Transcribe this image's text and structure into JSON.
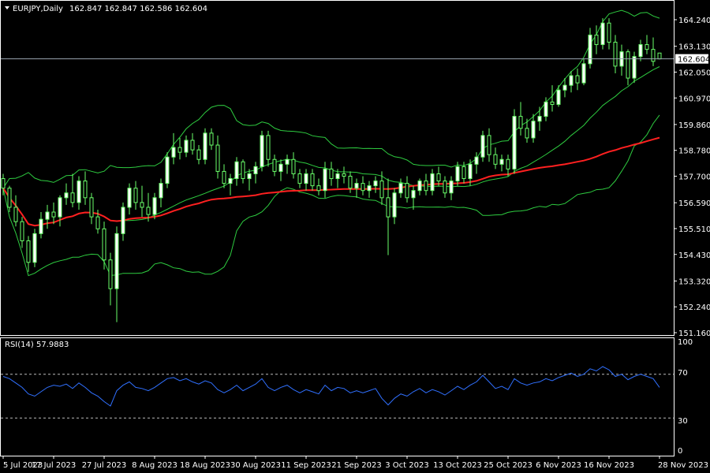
{
  "header": {
    "symbol": "EURJPY,Daily",
    "ohlc": "162.847 162.847 162.586 162.604",
    "price_tag": "162.604"
  },
  "indicator": {
    "label": "RSI(14) 57.9883",
    "levels": [
      "100",
      "70",
      "30",
      "0"
    ]
  },
  "colors": {
    "background": "#000000",
    "frame": "#ffffff",
    "bollinger": "#2ecc40",
    "ma": "#ff2020",
    "rsi": "#3070ff",
    "bull_body": "#ffffff",
    "bear_body": "#000000",
    "wick": "#6aff6a"
  },
  "chart_data": [
    {
      "type": "candlestick",
      "title": "EURJPY,Daily",
      "yticks": [
        "164.240",
        "163.130",
        "162.050",
        "160.970",
        "159.860",
        "158.780",
        "157.700",
        "156.590",
        "155.510",
        "154.430",
        "153.320",
        "152.240",
        "151.160"
      ],
      "ylim": [
        151.16,
        164.24
      ],
      "xticks": [
        "5 Jul 2023",
        "17 Jul 2023",
        "27 Jul 2023",
        "8 Aug 2023",
        "18 Aug 2023",
        "30 Aug 2023",
        "11 Sep 2023",
        "21 Sep 2023",
        "3 Oct 2023",
        "13 Oct 2023",
        "25 Oct 2023",
        "6 Nov 2023",
        "16 Nov 2023",
        "28 Nov 2023"
      ],
      "current_price": 162.604,
      "series": [
        {
          "values": [
            [
              157.6,
              157.8,
              156.9,
              157.2
            ],
            [
              157.2,
              157.3,
              156.2,
              156.4
            ],
            [
              156.4,
              156.9,
              155.6,
              155.8
            ],
            [
              155.8,
              156.0,
              154.7,
              155.0
            ],
            [
              155.0,
              155.2,
              153.7,
              154.1
            ],
            [
              154.1,
              155.5,
              153.9,
              155.3
            ],
            [
              155.3,
              156.2,
              155.1,
              155.9
            ],
            [
              155.9,
              156.5,
              155.5,
              156.2
            ],
            [
              156.2,
              156.6,
              155.7,
              156.0
            ],
            [
              156.0,
              156.9,
              155.6,
              156.8
            ],
            [
              156.8,
              157.4,
              156.5,
              157.0
            ],
            [
              157.0,
              157.8,
              156.4,
              156.6
            ],
            [
              156.6,
              157.7,
              156.3,
              157.5
            ],
            [
              157.5,
              157.9,
              156.5,
              156.8
            ],
            [
              156.8,
              157.0,
              155.7,
              156.0
            ],
            [
              156.0,
              156.3,
              155.3,
              155.5
            ],
            [
              155.5,
              155.8,
              153.8,
              154.2
            ],
            [
              154.2,
              154.5,
              152.3,
              153.0
            ],
            [
              153.0,
              155.6,
              151.6,
              155.3
            ],
            [
              155.3,
              156.6,
              155.0,
              156.4
            ],
            [
              156.4,
              157.4,
              156.1,
              157.2
            ],
            [
              157.2,
              157.5,
              156.3,
              156.6
            ],
            [
              156.6,
              157.3,
              156.0,
              156.4
            ],
            [
              156.4,
              157.0,
              155.8,
              156.1
            ],
            [
              156.1,
              157.0,
              155.9,
              156.8
            ],
            [
              156.8,
              157.6,
              156.4,
              157.4
            ],
            [
              157.4,
              158.7,
              157.2,
              158.5
            ],
            [
              158.5,
              159.5,
              158.2,
              158.9
            ],
            [
              158.9,
              159.3,
              158.4,
              158.7
            ],
            [
              158.7,
              159.4,
              158.5,
              159.2
            ],
            [
              159.2,
              159.5,
              158.6,
              158.8
            ],
            [
              158.8,
              159.0,
              158.2,
              158.4
            ],
            [
              158.4,
              159.7,
              158.2,
              159.5
            ],
            [
              159.5,
              159.7,
              158.8,
              159.0
            ],
            [
              159.0,
              159.4,
              157.6,
              157.9
            ],
            [
              157.9,
              158.2,
              157.2,
              157.4
            ],
            [
              157.4,
              157.8,
              156.9,
              157.6
            ],
            [
              157.6,
              158.5,
              157.3,
              158.3
            ],
            [
              158.3,
              158.4,
              157.4,
              157.6
            ],
            [
              157.6,
              158.0,
              157.1,
              157.8
            ],
            [
              157.8,
              158.3,
              157.4,
              158.1
            ],
            [
              158.1,
              159.6,
              157.9,
              159.4
            ],
            [
              159.4,
              159.6,
              158.1,
              158.4
            ],
            [
              158.4,
              158.6,
              157.7,
              157.9
            ],
            [
              157.9,
              158.4,
              157.5,
              158.2
            ],
            [
              158.2,
              158.6,
              157.8,
              158.4
            ],
            [
              158.4,
              158.7,
              157.6,
              157.8
            ],
            [
              157.8,
              158.0,
              157.2,
              157.4
            ],
            [
              157.4,
              158.0,
              157.1,
              157.8
            ],
            [
              157.8,
              158.0,
              157.1,
              157.3
            ],
            [
              157.3,
              157.6,
              156.9,
              157.1
            ],
            [
              157.1,
              158.3,
              156.8,
              158.0
            ],
            [
              158.0,
              158.3,
              157.3,
              157.6
            ],
            [
              157.6,
              158.0,
              157.2,
              157.8
            ],
            [
              157.8,
              158.1,
              157.4,
              157.7
            ],
            [
              157.7,
              157.9,
              157.0,
              157.2
            ],
            [
              157.2,
              157.6,
              156.8,
              157.4
            ],
            [
              157.4,
              157.7,
              156.9,
              157.1
            ],
            [
              157.1,
              157.5,
              156.8,
              157.3
            ],
            [
              157.3,
              157.7,
              157.0,
              157.5
            ],
            [
              157.5,
              157.9,
              156.5,
              156.8
            ],
            [
              156.8,
              157.6,
              154.4,
              156.0
            ],
            [
              156.0,
              157.2,
              155.7,
              157.0
            ],
            [
              157.0,
              157.6,
              156.8,
              157.4
            ],
            [
              157.4,
              157.7,
              156.6,
              156.8
            ],
            [
              156.8,
              157.3,
              156.3,
              157.1
            ],
            [
              157.1,
              157.6,
              156.9,
              157.5
            ],
            [
              157.5,
              157.8,
              156.9,
              157.1
            ],
            [
              157.1,
              158.0,
              156.9,
              157.8
            ],
            [
              157.8,
              158.1,
              157.3,
              157.5
            ],
            [
              157.5,
              157.7,
              156.8,
              157.0
            ],
            [
              157.0,
              157.7,
              156.7,
              157.5
            ],
            [
              157.5,
              158.3,
              157.3,
              158.1
            ],
            [
              158.1,
              158.3,
              157.4,
              157.6
            ],
            [
              157.6,
              158.4,
              157.3,
              158.2
            ],
            [
              158.2,
              158.7,
              157.8,
              158.5
            ],
            [
              158.5,
              159.6,
              158.3,
              159.4
            ],
            [
              159.4,
              159.7,
              158.3,
              158.6
            ],
            [
              158.6,
              158.9,
              158.0,
              158.2
            ],
            [
              158.2,
              158.6,
              157.9,
              158.4
            ],
            [
              158.4,
              158.6,
              157.7,
              158.0
            ],
            [
              158.0,
              160.5,
              157.8,
              160.2
            ],
            [
              160.2,
              160.8,
              159.4,
              159.7
            ],
            [
              159.7,
              160.1,
              159.1,
              159.3
            ],
            [
              159.3,
              160.3,
              159.1,
              160.0
            ],
            [
              160.0,
              160.6,
              159.6,
              160.2
            ],
            [
              160.2,
              161.0,
              160.0,
              160.8
            ],
            [
              160.8,
              161.5,
              160.4,
              160.7
            ],
            [
              160.7,
              161.5,
              160.6,
              161.3
            ],
            [
              161.3,
              161.8,
              161.0,
              161.5
            ],
            [
              161.5,
              162.1,
              161.2,
              161.9
            ],
            [
              161.9,
              162.2,
              161.3,
              161.6
            ],
            [
              161.6,
              162.6,
              161.5,
              162.4
            ],
            [
              162.4,
              163.9,
              162.2,
              163.6
            ],
            [
              163.6,
              164.0,
              162.8,
              163.2
            ],
            [
              163.2,
              164.3,
              163.0,
              164.1
            ],
            [
              164.1,
              164.3,
              163.0,
              163.3
            ],
            [
              163.3,
              163.6,
              162.0,
              162.3
            ],
            [
              162.3,
              163.2,
              161.9,
              162.9
            ],
            [
              162.9,
              163.0,
              161.5,
              161.8
            ],
            [
              161.8,
              162.9,
              161.6,
              162.7
            ],
            [
              162.7,
              163.4,
              162.5,
              163.2
            ],
            [
              163.2,
              163.6,
              162.8,
              163.0
            ],
            [
              163.0,
              163.5,
              162.3,
              162.5
            ],
            [
              162.847,
              162.847,
              162.586,
              162.604
            ]
          ]
        }
      ]
    },
    {
      "type": "line",
      "title": "RSI(14) 57.9883",
      "ylim": [
        0,
        100
      ],
      "levels": [
        70,
        30
      ],
      "series": [
        {
          "values": [
            68,
            66,
            62,
            58,
            52,
            50,
            54,
            58,
            60,
            59,
            61,
            57,
            62,
            58,
            53,
            50,
            45,
            41,
            55,
            60,
            63,
            58,
            57,
            55,
            58,
            62,
            66,
            67,
            64,
            66,
            63,
            61,
            64,
            62,
            56,
            53,
            56,
            60,
            55,
            58,
            61,
            66,
            58,
            55,
            58,
            60,
            56,
            53,
            56,
            54,
            52,
            60,
            55,
            58,
            57,
            53,
            55,
            53,
            55,
            57,
            48,
            42,
            48,
            52,
            50,
            54,
            57,
            53,
            56,
            54,
            51,
            55,
            59,
            56,
            60,
            63,
            69,
            63,
            57,
            59,
            56,
            66,
            62,
            60,
            62,
            63,
            66,
            64,
            67,
            69,
            71,
            68,
            70,
            75,
            73,
            77,
            74,
            68,
            70,
            65,
            68,
            70,
            68,
            66,
            58
          ]
        }
      ]
    }
  ]
}
